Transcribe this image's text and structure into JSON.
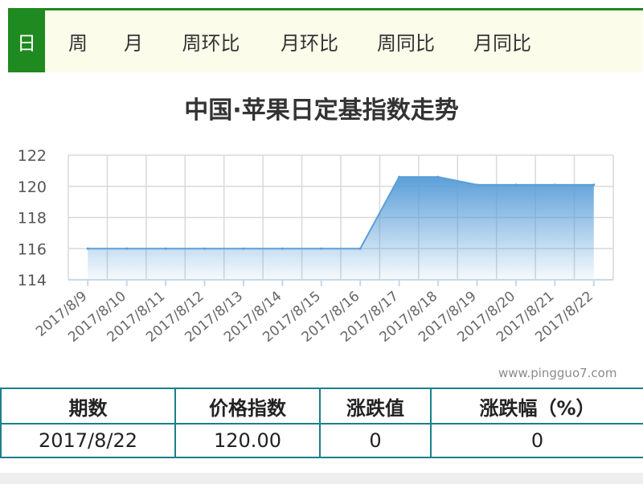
{
  "tabs": [
    {
      "label": "日",
      "active": true
    },
    {
      "label": "周",
      "active": false
    },
    {
      "label": "月",
      "active": false
    },
    {
      "label": "周环比",
      "active": false
    },
    {
      "label": "月环比",
      "active": false
    },
    {
      "label": "周同比",
      "active": false
    },
    {
      "label": "月同比",
      "active": false
    }
  ],
  "watermark": "www.pingguo7.com",
  "table": {
    "headers": [
      "期数",
      "价格指数",
      "涨跌值",
      "涨跌幅（%）"
    ],
    "row": [
      "2017/8/22",
      "120.00",
      "0",
      "0"
    ]
  },
  "colors": {
    "accent": "#1f8a1f",
    "tab_bar_bg": "#fbfcea",
    "area_top": "#5b9fd8",
    "table_border": "#1a7f8c"
  },
  "chart_data": {
    "type": "area",
    "title": "中国·苹果日定基指数走势",
    "xlabel": "",
    "ylabel": "",
    "categories": [
      "2017/8/9",
      "2017/8/10",
      "2017/8/11",
      "2017/8/12",
      "2017/8/13",
      "2017/8/14",
      "2017/8/15",
      "2017/8/16",
      "2017/8/17",
      "2017/8/18",
      "2017/8/19",
      "2017/8/20",
      "2017/8/21",
      "2017/8/22"
    ],
    "values": [
      116,
      116,
      116,
      116,
      116,
      116,
      116,
      116,
      120.6,
      120.6,
      120.1,
      120.1,
      120.1,
      120.1
    ],
    "yticks": [
      114,
      116,
      118,
      120,
      122
    ],
    "ylim": [
      114,
      122
    ],
    "grid": true,
    "legend": "none"
  }
}
